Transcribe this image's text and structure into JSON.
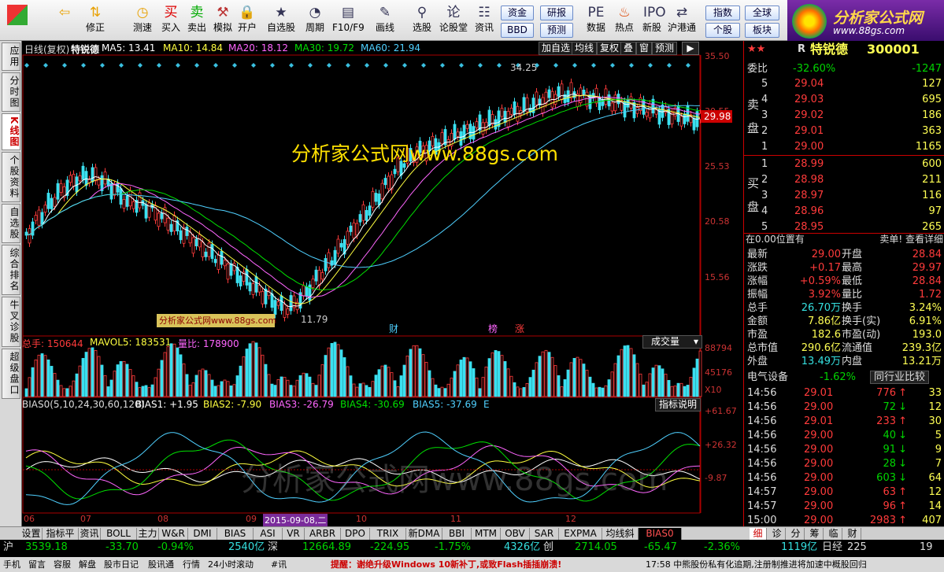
{
  "toolbar": {
    "buttons": [
      {
        "label": "",
        "icon": "grid-icon"
      },
      {
        "label": "",
        "icon": "back-arrow-icon"
      },
      {
        "label": "修正",
        "icon": "arrow-updown-icon"
      },
      {
        "label": "测速",
        "icon": "clock-icon"
      },
      {
        "label": "买入",
        "icon": "buy-icon"
      },
      {
        "label": "卖出",
        "icon": "sell-icon"
      },
      {
        "label": "模拟",
        "icon": "hammer-icon"
      },
      {
        "label": "开户",
        "icon": "lock-icon"
      },
      {
        "label": "自选股",
        "icon": "star-icon"
      },
      {
        "label": "周期",
        "icon": "gauge-icon"
      },
      {
        "label": "F10/F9",
        "icon": "f10-icon"
      },
      {
        "label": "画线",
        "icon": "pen-icon"
      },
      {
        "label": "选股",
        "icon": "pick-icon"
      },
      {
        "label": "论股堂",
        "icon": "discuss-icon"
      },
      {
        "label": "资讯",
        "icon": "news-icon"
      },
      {
        "label": "数据",
        "icon": "pe-icon"
      },
      {
        "label": "热点",
        "icon": "fire-icon"
      },
      {
        "label": "新股",
        "icon": "ipo-icon"
      },
      {
        "label": "沪港通",
        "icon": "sse-hkex-icon"
      }
    ],
    "small": [
      "资金",
      "BBD",
      "研报",
      "预测",
      "指数",
      "个股",
      "全球",
      "板块"
    ]
  },
  "logo": {
    "line1": "分析家公式网",
    "line2": "www.88gs.com"
  },
  "left_tabs": [
    "应用",
    "分时图",
    "K线图",
    "个股资料",
    "自选股",
    "综合排名",
    "牛叉诊股",
    "超级盘口"
  ],
  "header": {
    "period": "日线(复权)",
    "stock": "特锐德",
    "ma": [
      {
        "label": "MA5: 13.41",
        "color": "#ffffff"
      },
      {
        "label": "MA10: 14.84",
        "color": "#ffff40"
      },
      {
        "label": "MA20: 18.12",
        "color": "#ff66ff"
      },
      {
        "label": "MA30: 19.72",
        "color": "#00e000"
      },
      {
        "label": "MA60: 21.94",
        "color": "#4fd0ff"
      }
    ],
    "buttons": [
      "加自选",
      "均线",
      "复权",
      "叠",
      "窗",
      "预测"
    ]
  },
  "price_axis": [
    "35.50",
    "30.55",
    "25.53",
    "20.58",
    "15.56"
  ],
  "current_price": "29.98",
  "watermark": "分析家公式网www.88gs.com",
  "watermark2": "分析家公式网www.88gs.com",
  "small_watermark": "分析家公式网www.88gs.com",
  "hi_label": "34.25",
  "lo_label": "11.79",
  "events": [
    {
      "label": "财",
      "color": "#4fd0ff"
    },
    {
      "label": "榜",
      "color": "#ff66ff"
    },
    {
      "label": "涨",
      "color": "#ff3b3b"
    }
  ],
  "vol": {
    "header": [
      {
        "label": "总手: 150644",
        "color": "#ff3b3b"
      },
      {
        "label": "MAVOL5: 183531",
        "color": "#ffff40"
      },
      {
        "label": "量比: 178900",
        "color": "#ff66ff"
      }
    ],
    "title": "成交量",
    "axis": [
      "88794",
      "45176",
      "X10"
    ]
  },
  "bias": {
    "header": [
      {
        "label": "BIAS0(5,10,24,30,60,120)",
        "color": "#dddddd"
      },
      {
        "label": "BIAS1: +1.95",
        "color": "#ffffff"
      },
      {
        "label": "BIAS2: -7.90",
        "color": "#ffff40"
      },
      {
        "label": "BIAS3: -26.79",
        "color": "#ff66ff"
      },
      {
        "label": "BIAS4: -30.69",
        "color": "#00e000"
      },
      {
        "label": "BIAS5: -37.69",
        "color": "#4fd0ff"
      },
      {
        "label": "E",
        "color": "#4fd0ff"
      }
    ],
    "title": "指标说明",
    "axis": [
      "+61.67",
      "+26.32",
      "-9.87"
    ]
  },
  "dates": [
    "06",
    "07",
    "08",
    "09",
    "2015-09-08,二",
    "10",
    "11",
    "12"
  ],
  "quote": {
    "stars": "★★",
    "r": "R",
    "name": "特锐德",
    "code": "300001",
    "weibi": "委比",
    "weibi_pct": "-32.60%",
    "weibi_diff": "-1247",
    "sell_label": [
      "卖",
      "盘"
    ],
    "buy_label": [
      "买",
      "盘"
    ],
    "asks": [
      {
        "n": "5",
        "p": "29.04",
        "v": "127"
      },
      {
        "n": "4",
        "p": "29.03",
        "v": "695"
      },
      {
        "n": "3",
        "p": "29.02",
        "v": "186"
      },
      {
        "n": "2",
        "p": "29.01",
        "v": "363"
      },
      {
        "n": "1",
        "p": "29.00",
        "v": "1165"
      }
    ],
    "bids": [
      {
        "n": "1",
        "p": "28.99",
        "v": "600"
      },
      {
        "n": "2",
        "p": "28.98",
        "v": "211"
      },
      {
        "n": "3",
        "p": "28.97",
        "v": "116"
      },
      {
        "n": "4",
        "p": "28.96",
        "v": "97"
      },
      {
        "n": "5",
        "p": "28.95",
        "v": "265"
      }
    ],
    "pos": "在0.00位置有",
    "pos_right": "卖单! 查看详细",
    "stats": [
      [
        "最新",
        "29.00",
        "开盘",
        "28.84"
      ],
      [
        "涨跌",
        "+0.17",
        "最高",
        "29.97"
      ],
      [
        "涨幅",
        "+0.59%",
        "最低",
        "28.84"
      ],
      [
        "振幅",
        "3.92%",
        "量比",
        "1.72"
      ],
      [
        "总手",
        "26.70万",
        "换手",
        "3.24%"
      ],
      [
        "金额",
        "7.86亿",
        "换手(实)",
        "6.91%"
      ],
      [
        "市盈",
        "182.6",
        "市盈(动)",
        "193.0"
      ],
      [
        "总市值",
        "290.6亿",
        "流通值",
        "239.3亿"
      ],
      [
        "外盘",
        "13.49万",
        "内盘",
        "13.21万"
      ]
    ],
    "sector": "电气设备",
    "sector_pct": "-1.62%",
    "compare": "同行业比较",
    "ticks": [
      [
        "14:56",
        "29.01",
        "776",
        "33"
      ],
      [
        "14:56",
        "29.00",
        "72",
        "12"
      ],
      [
        "14:56",
        "29.01",
        "233",
        "30"
      ],
      [
        "14:56",
        "29.00",
        "40",
        "5"
      ],
      [
        "14:56",
        "29.00",
        "91",
        "9"
      ],
      [
        "14:56",
        "29.00",
        "28",
        "7"
      ],
      [
        "14:56",
        "29.00",
        "603",
        "64"
      ],
      [
        "14:57",
        "29.00",
        "63",
        "12"
      ],
      [
        "14:57",
        "29.00",
        "96",
        "14"
      ],
      [
        "15:00",
        "29.00",
        "2983",
        "407"
      ]
    ]
  },
  "tabs": [
    "设置",
    "指标平台",
    "资讯",
    "BOLL",
    "主力",
    "W&R",
    "DMI",
    "BIAS",
    "ASI",
    "VR",
    "ARBR",
    "DPO",
    "TRIX",
    "新DMA",
    "BBI",
    "MTM",
    "OBV",
    "SAR",
    "EXPMA",
    "均线斜率",
    "BIAS0"
  ],
  "detail_tabs": [
    "细",
    "诊",
    "分",
    "筹",
    "临",
    "财"
  ],
  "status": {
    "sh_label": "沪",
    "sh_val": "3539.18",
    "sh_chg": "-33.70",
    "sh_pct": "-0.94%",
    "sh_amt": "2540亿",
    "sz_label": "深",
    "sz_val": "12664.89",
    "sz_chg": "-224.95",
    "sz_pct": "-1.75%",
    "sz_amt": "4326亿",
    "cy_label": "创",
    "cy_val": "2714.05",
    "cy_chg": "-65.47",
    "cy_pct": "-2.36%",
    "cy_amt": "1119亿",
    "rj_label": "日经",
    "rj_val": "225",
    "end": "19"
  },
  "bottom": {
    "items": [
      "手机",
      "留言",
      "容服",
      "解盘",
      "股市日记",
      "股讯通",
      "行情",
      "24小时滚动",
      "#讯"
    ],
    "ticker": "提醒：谢绝升级Windows 10新补丁,或致Flash插插崩溃!",
    "ticker2": "17:58 中熊股份私有化追期,注册制推进将加速中概股回归"
  }
}
